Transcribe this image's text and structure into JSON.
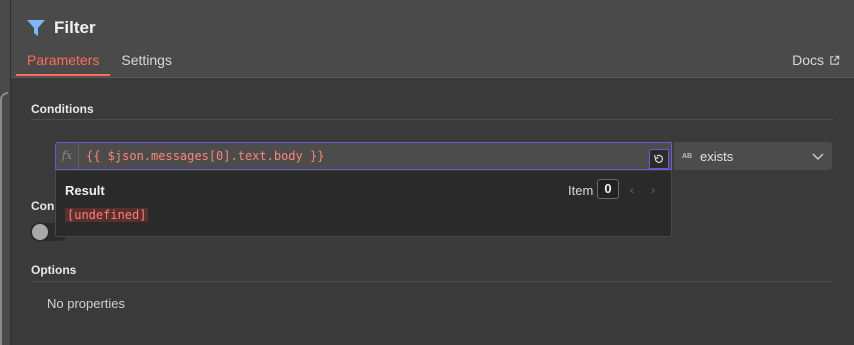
{
  "header": {
    "title": "Filter",
    "tabs": [
      {
        "label": "Parameters",
        "active": true
      },
      {
        "label": "Settings",
        "active": false
      }
    ],
    "docs_label": "Docs"
  },
  "conditions": {
    "label": "Conditions",
    "expression": "{{ $json.messages[0].text.body }}",
    "fx_label": "fx",
    "operator_type": "AB",
    "operator": "exists"
  },
  "result_popup": {
    "title": "Result",
    "item_label": "Item",
    "item_index": "0",
    "value": "[undefined]",
    "prev": "‹",
    "next": "›"
  },
  "combinator": {
    "label": "Con",
    "toggle_on": false
  },
  "options": {
    "label": "Options",
    "empty_text": "No properties"
  },
  "colors": {
    "accent": "#ff6d5a",
    "focus_border": "#6a5cc8",
    "expression_text": "#ff8378",
    "filter_icon": "#7fb6f7"
  },
  "icons": {
    "title": "filter-icon",
    "docs": "external-link-icon",
    "expand": "expand-editor-icon",
    "select": "chevron-down-icon"
  }
}
